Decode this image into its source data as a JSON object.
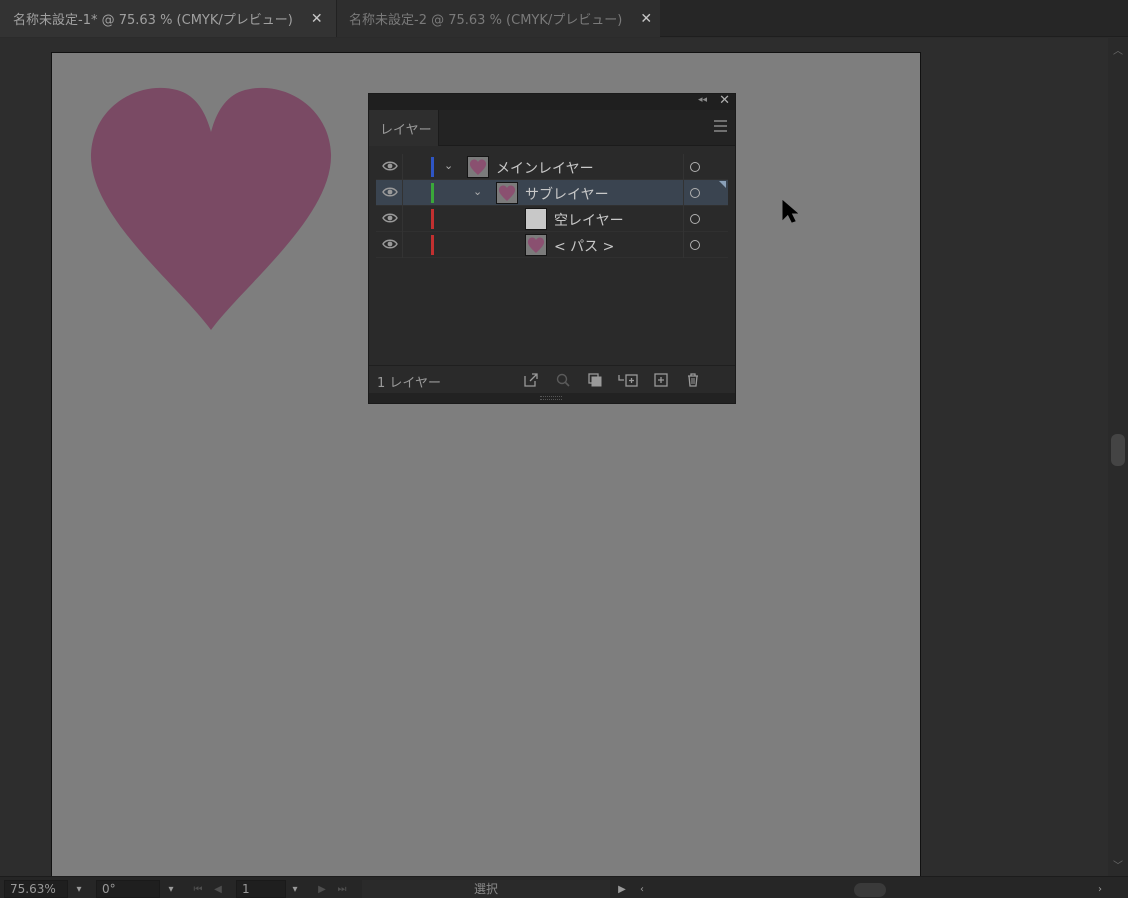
{
  "tabs": [
    {
      "label": "名称未設定-1* @ 75.63 % (CMYK/プレビュー)",
      "active": true,
      "close": "✕"
    },
    {
      "label": "名称未設定-2 @ 75.63 % (CMYK/プレビュー)",
      "active": false,
      "close": "✕"
    }
  ],
  "colors": {
    "heart": "#7a4a64",
    "artboard": "#7e7e7e",
    "main_layer": "#2e55c4",
    "sub_layer": "#3aa83a",
    "child_layer": "#c23030"
  },
  "layers_panel": {
    "tab_label": "レイヤー",
    "collapse_glyph": "◂◂",
    "close_glyph": "✕",
    "rows": [
      {
        "name": "メインレイヤー",
        "chevron": "⌄",
        "thumb": "heart",
        "selected": false
      },
      {
        "name": "サブレイヤー",
        "chevron": "⌄",
        "thumb": "heart",
        "selected": true
      },
      {
        "name": "空レイヤー",
        "chevron": "",
        "thumb": "empty",
        "selected": false
      },
      {
        "name": "< パス >",
        "chevron": "",
        "thumb": "heart",
        "selected": false
      }
    ],
    "footer_count": "1 レイヤー"
  },
  "statusbar": {
    "zoom": "75.63%",
    "rotation": "0°",
    "artboard_number": "1",
    "status_text": "選択"
  }
}
